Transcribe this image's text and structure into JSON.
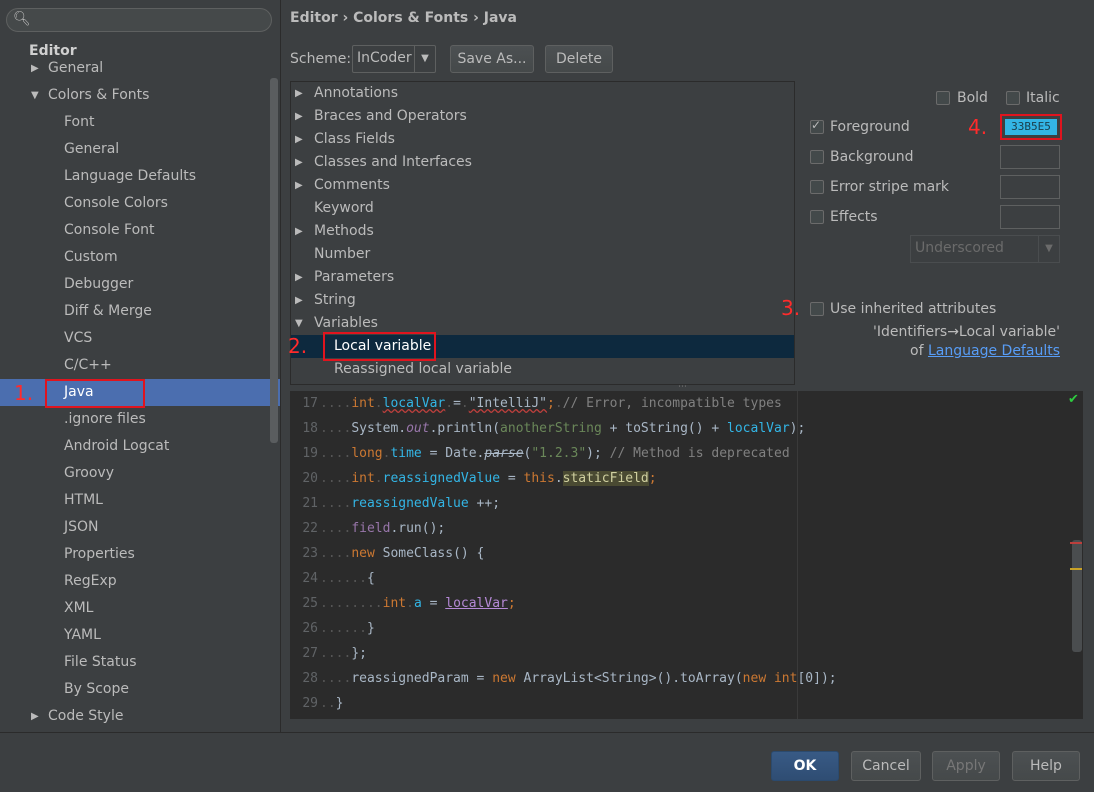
{
  "sidebar": {
    "search_placeholder": "",
    "items": [
      {
        "label": "Editor",
        "bold": true
      },
      {
        "label": "General"
      },
      {
        "label": "Colors & Fonts"
      },
      {
        "label": "Font"
      },
      {
        "label": "General"
      },
      {
        "label": "Language Defaults"
      },
      {
        "label": "Console Colors"
      },
      {
        "label": "Console Font"
      },
      {
        "label": "Custom"
      },
      {
        "label": "Debugger"
      },
      {
        "label": "Diff & Merge"
      },
      {
        "label": "VCS"
      },
      {
        "label": "C/C++"
      },
      {
        "label": "Java"
      },
      {
        "label": ".ignore files"
      },
      {
        "label": "Android Logcat"
      },
      {
        "label": "Groovy"
      },
      {
        "label": "HTML"
      },
      {
        "label": "JSON"
      },
      {
        "label": "Properties"
      },
      {
        "label": "RegExp"
      },
      {
        "label": "XML"
      },
      {
        "label": "YAML"
      },
      {
        "label": "File Status"
      },
      {
        "label": "By Scope"
      },
      {
        "label": "Code Style"
      }
    ]
  },
  "breadcrumb": "Editor › Colors & Fonts › Java",
  "scheme": {
    "label": "Scheme:",
    "value": "InCoder",
    "save_as": "Save As...",
    "delete": "Delete"
  },
  "elements": [
    {
      "label": "Annotations"
    },
    {
      "label": "Braces and Operators"
    },
    {
      "label": "Class Fields"
    },
    {
      "label": "Classes and Interfaces"
    },
    {
      "label": "Comments"
    },
    {
      "label": "Keyword"
    },
    {
      "label": "Methods"
    },
    {
      "label": "Number"
    },
    {
      "label": "Parameters"
    },
    {
      "label": "String"
    },
    {
      "label": "Variables"
    },
    {
      "label": "Local variable"
    },
    {
      "label": "Reassigned local variable"
    }
  ],
  "attributes": {
    "bold": "Bold",
    "italic": "Italic",
    "foreground": "Foreground",
    "foreground_color": "33B5E5",
    "background": "Background",
    "error_stripe": "Error stripe mark",
    "effects": "Effects",
    "effects_type": "Underscored",
    "use_inherited": "Use inherited attributes",
    "inherited_from": "'Identifiers→Local variable'",
    "of": "of",
    "inherited_link": "Language Defaults"
  },
  "annotations": {
    "one": "1.",
    "two": "2.",
    "three": "3.",
    "four": "4."
  },
  "code_lines": [
    {
      "n": "17"
    },
    {
      "n": "18"
    },
    {
      "n": "19"
    },
    {
      "n": "20"
    },
    {
      "n": "21"
    },
    {
      "n": "22"
    },
    {
      "n": "23"
    },
    {
      "n": "24"
    },
    {
      "n": "25"
    },
    {
      "n": "26"
    },
    {
      "n": "27"
    },
    {
      "n": "28"
    },
    {
      "n": "29"
    }
  ],
  "code": {
    "l17": [
      "int",
      "localVar",
      "=",
      "\"IntelliJ\"",
      ";",
      "// Error, incompatible types"
    ],
    "l18": [
      "System.",
      "out",
      ".println(",
      "anotherString",
      " + toString() + ",
      "localVar",
      ");"
    ],
    "l19": [
      "long",
      "time",
      " = Date.",
      "parse",
      "(",
      "\"1.2.3\"",
      "); ",
      "// Method is deprecated"
    ],
    "l20": [
      "int",
      "reassignedValue",
      " = ",
      "this",
      ".",
      "staticField",
      ";"
    ],
    "l21": [
      "reassignedValue",
      " ++;"
    ],
    "l22": [
      "field",
      ".run();"
    ],
    "l23": [
      "new",
      " SomeClass() {"
    ],
    "l24": [
      "{"
    ],
    "l25": [
      "int",
      "a",
      " = ",
      "localVar",
      ";"
    ],
    "l26": [
      "}"
    ],
    "l27": [
      "};"
    ],
    "l28": [
      "reassignedParam",
      " = ",
      "new",
      " ArrayList<String>().toArray(",
      "new",
      " ",
      "int",
      "[0]);"
    ],
    "l29": [
      "}"
    ]
  },
  "footer": {
    "ok": "OK",
    "cancel": "Cancel",
    "apply": "Apply",
    "help": "Help"
  },
  "colors": {
    "selection": "#4b6eaf",
    "accent_blue": "#33b5e5",
    "annotation_red": "#e0141e"
  }
}
